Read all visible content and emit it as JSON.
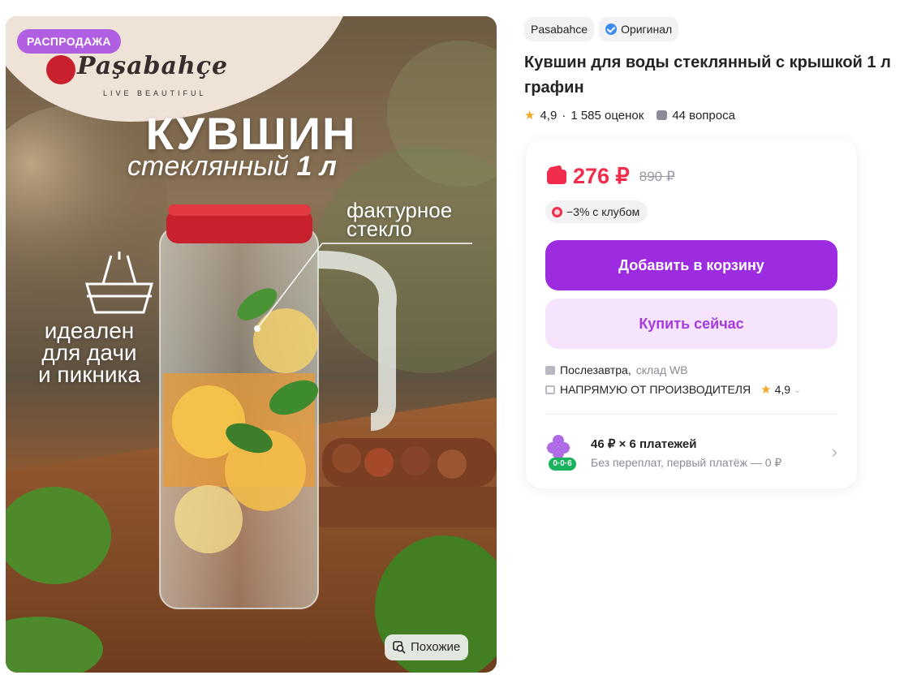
{
  "image": {
    "sale_badge": "РАСПРОДАЖА",
    "brand_name": "Paşabahçe",
    "brand_tagline": "LIVE BEAUTIFUL",
    "headline": "КУВШИН",
    "subheadline": "стеклянный",
    "subheadline_bold": "1 л",
    "callout_lines": [
      "фактурное",
      "стекло"
    ],
    "side_lines": [
      "идеален",
      "для дачи",
      "и пикника"
    ],
    "similar_button": "Похожие"
  },
  "chips": {
    "brand": "Pasabahce",
    "original": "Оригинал"
  },
  "product": {
    "title": "Кувшин для воды стеклянный с крышкой 1 л графин",
    "rating": "4,9",
    "separator": "·",
    "reviews": "1 585 оценок",
    "questions": "44 вопроса"
  },
  "buy_card": {
    "price": "276 ₽",
    "old_price": "890 ₽",
    "club_discount": "−3% с клубом",
    "add_to_cart": "Добавить в корзину",
    "buy_now": "Купить сейчас",
    "delivery_date": "Послезавтра,",
    "delivery_warehouse": "склад WB",
    "seller": "НАПРЯМУЮ ОТ ПРОИЗВОДИТЕЛЯ",
    "seller_rating": "4,9",
    "installment_title": "46 ₽ × 6 платежей",
    "installment_subtitle": "Без переплат, первый платёж — 0 ₽",
    "installment_tag": "0·0·6"
  },
  "colors": {
    "accent_purple": "#9d2bdf",
    "price_red": "#f22c4c",
    "sale_badge": "#b05fe3",
    "buy_now_bg": "#f5e4fb",
    "star": "#f5a623"
  },
  "icons": [
    "verified-icon",
    "star-icon",
    "question-icon",
    "wallet-icon",
    "club-icon",
    "box-icon",
    "store-icon",
    "chevron-down-icon",
    "chevron-right-icon",
    "similar-search-icon",
    "basket-icon"
  ]
}
